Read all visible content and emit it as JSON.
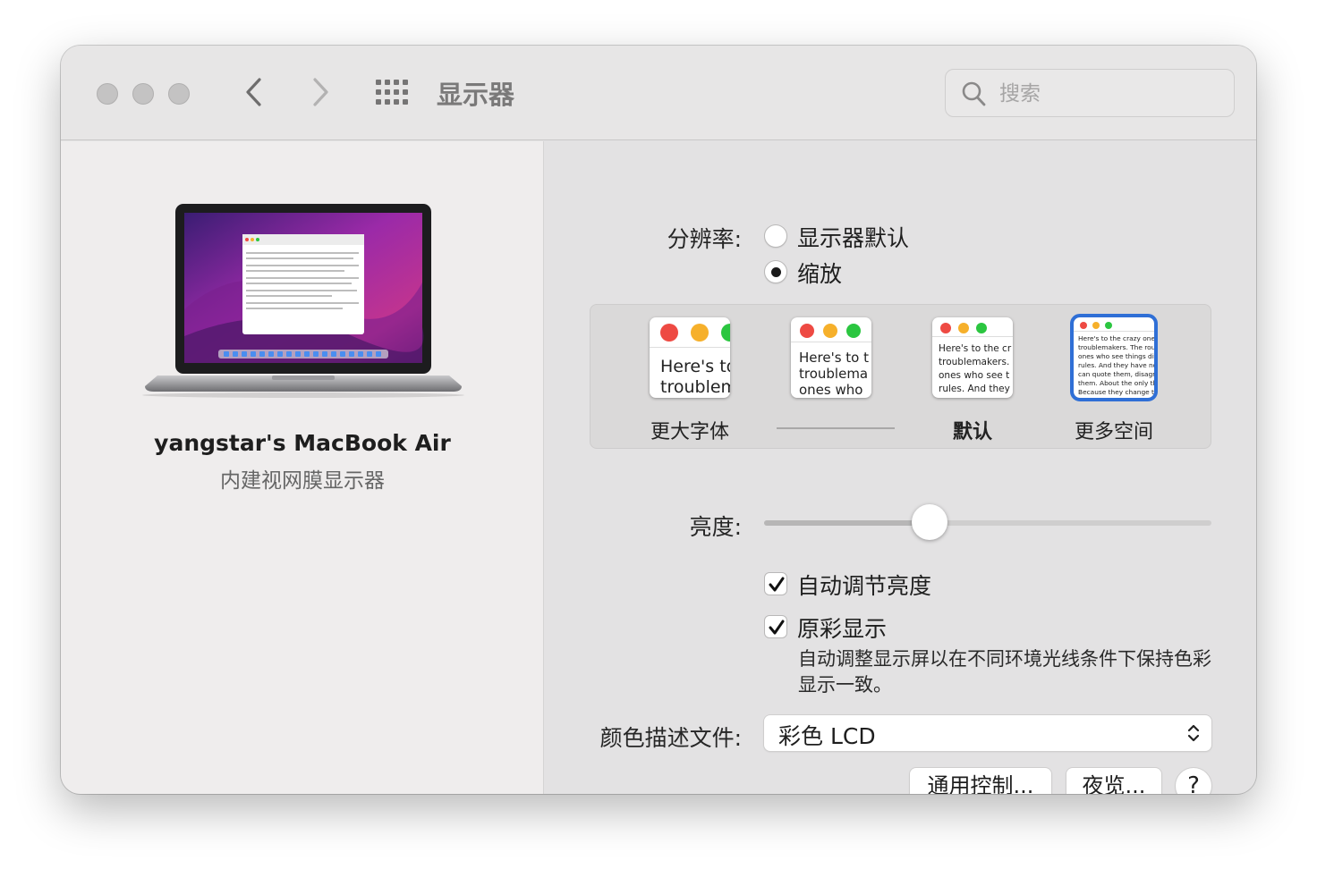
{
  "window": {
    "title": "显示器"
  },
  "search": {
    "placeholder": "搜索"
  },
  "sidebar": {
    "device_name": "yangstar's MacBook Air",
    "device_type": "内建视网膜显示器"
  },
  "resolution": {
    "label": "分辨率:",
    "options": [
      {
        "label": "显示器默认",
        "selected": false
      },
      {
        "label": "缩放",
        "selected": true
      }
    ]
  },
  "scaling": {
    "options": [
      {
        "label": "更大字体",
        "preview_text": "Here's to\ntroublem",
        "selected": false
      },
      {
        "label": "",
        "preview_text": "Here's to t\ntroublema\nones who",
        "selected": false
      },
      {
        "label": "默认",
        "preview_text": "Here's to the cr\ntroublemakers.\nones who see t\nrules. And they",
        "selected": false
      },
      {
        "label": "更多空间",
        "preview_text": "Here's to the crazy one\ntroublemakers. The rou\nones who see things dif\nrules. And they have no\ncan quote them, disagr\nthem. About the only th\nBecause they change t",
        "selected": true
      }
    ]
  },
  "brightness": {
    "label": "亮度:",
    "value": 0.37
  },
  "auto_brightness": {
    "label": "自动调节亮度",
    "checked": true
  },
  "true_tone": {
    "label": "原彩显示",
    "checked": true,
    "description": "自动调整显示屏以在不同环境光线条件下保持色彩显示一致。"
  },
  "color_profile": {
    "label": "颜色描述文件:",
    "value": "彩色 LCD"
  },
  "buttons": {
    "universal_control": "通用控制...",
    "night_shift": "夜览...",
    "help": "?"
  },
  "colors": {
    "close": "#ee4a43",
    "minimize": "#f6b02b",
    "zoom": "#2bc640",
    "selection": "#2f6fd6"
  }
}
